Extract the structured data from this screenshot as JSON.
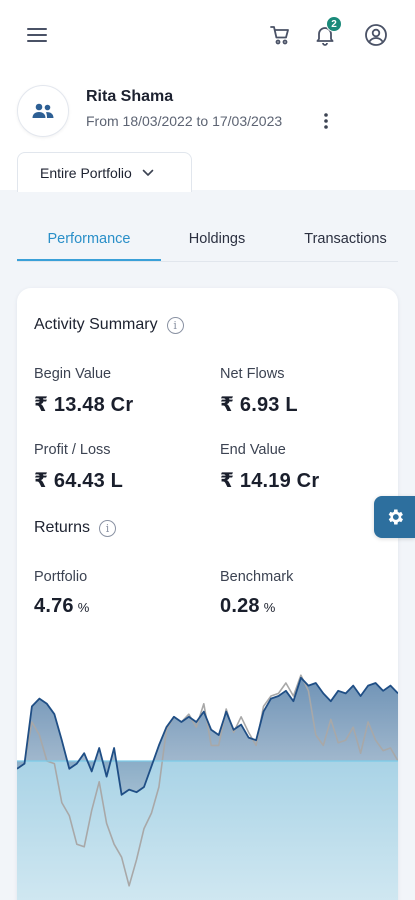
{
  "header": {
    "notification_count": "2",
    "icons": [
      "menu-icon",
      "cart-icon",
      "bell-icon",
      "user-circle-icon"
    ]
  },
  "profile": {
    "name": "Rita Shama",
    "date_range": "From 18/03/2022 to 17/03/2023"
  },
  "portfolio_selector": {
    "label": "Entire Portfolio"
  },
  "tabs": [
    {
      "label": "Performance",
      "active": true
    },
    {
      "label": "Holdings",
      "active": false
    },
    {
      "label": "Transactions",
      "active": false
    }
  ],
  "activity": {
    "title": "Activity Summary",
    "begin_value": {
      "label": "Begin Value",
      "value": "₹ 13.48 Cr"
    },
    "net_flows": {
      "label": "Net Flows",
      "value": "₹ 6.93 L"
    },
    "profit_loss": {
      "label": "Profit / Loss",
      "value": "₹ 64.43 L"
    },
    "end_value": {
      "label": "End Value",
      "value": "₹ 14.19 Cr"
    }
  },
  "returns": {
    "title": "Returns",
    "portfolio": {
      "label": "Portfolio",
      "value": "4.76",
      "unit": "%"
    },
    "benchmark": {
      "label": "Benchmark",
      "value": "0.28",
      "unit": "%"
    }
  },
  "chart_data": {
    "type": "area",
    "series": [
      {
        "values": [
          -3,
          -1,
          21,
          24,
          22,
          18,
          8,
          -3,
          -1,
          3,
          -4,
          5,
          -6,
          5,
          -13,
          -11,
          -12,
          -10,
          -2,
          6,
          13,
          17,
          15,
          17,
          15,
          19,
          12,
          10,
          19,
          12,
          14,
          9,
          8,
          19,
          24,
          25,
          27,
          23,
          32,
          29,
          30,
          26,
          23,
          27,
          26,
          29,
          25,
          29,
          30,
          27,
          29,
          26
        ]
      },
      {
        "values": [
          -3,
          -1,
          15,
          10,
          0,
          -1,
          -16,
          -21,
          -32,
          -33,
          -19,
          -8,
          -24,
          -32,
          -37,
          -48,
          -38,
          -26,
          -20,
          -10,
          12,
          17,
          15,
          18,
          13,
          22,
          6,
          6,
          20,
          11,
          17,
          11,
          6,
          21,
          25,
          26,
          30,
          25,
          33,
          27,
          10,
          6,
          16,
          7,
          8,
          13,
          3,
          15,
          8,
          4,
          5,
          0
        ]
      }
    ],
    "colors": {
      "portfolio_line": "#1f4e85",
      "benchmark_line": "#a8a8a8",
      "baseline": "#7ccbe8",
      "area_top": "#3f6f9e",
      "area_bottom": "#c7e2ee"
    }
  }
}
